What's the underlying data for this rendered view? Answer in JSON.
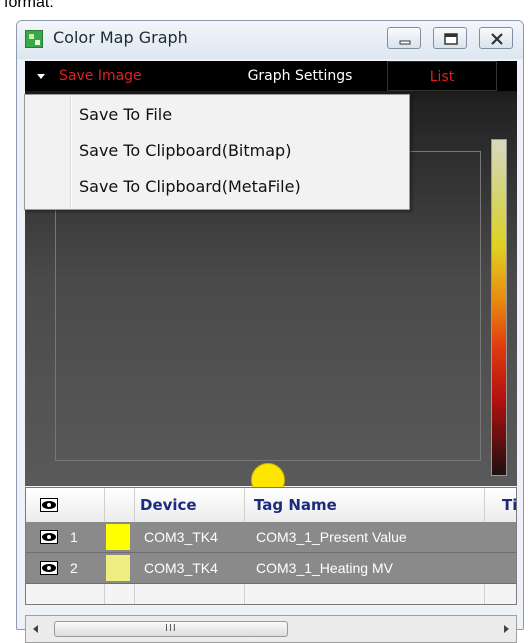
{
  "caption_fragment": "format:",
  "window": {
    "title": "Color Map Graph",
    "icon": "app-icon",
    "controls": [
      "minimize-icon",
      "maximize-icon",
      "close-icon"
    ]
  },
  "tabs": {
    "save_image": "Save Image",
    "graph_settings": "Graph Settings",
    "list": "List"
  },
  "menu": {
    "items": [
      "Save To File",
      "Save To Clipboard(Bitmap)",
      "Save To Clipboard(MetaFile)"
    ]
  },
  "grid": {
    "columns": [
      "Device",
      "Tag Name",
      "Ti"
    ],
    "rows": [
      {
        "index": "1",
        "color": "#ffff00",
        "device": "COM3_TK4",
        "tag": "COM3_1_Present Value"
      },
      {
        "index": "2",
        "color": "#eeee80",
        "device": "COM3_TK4",
        "tag": "COM3_1_Heating MV"
      }
    ]
  },
  "scrollbar": {
    "grip": "III"
  },
  "colors": {
    "accent_red": "#e02020",
    "marker": "#ffe600",
    "header_text": "#1c2b80"
  }
}
